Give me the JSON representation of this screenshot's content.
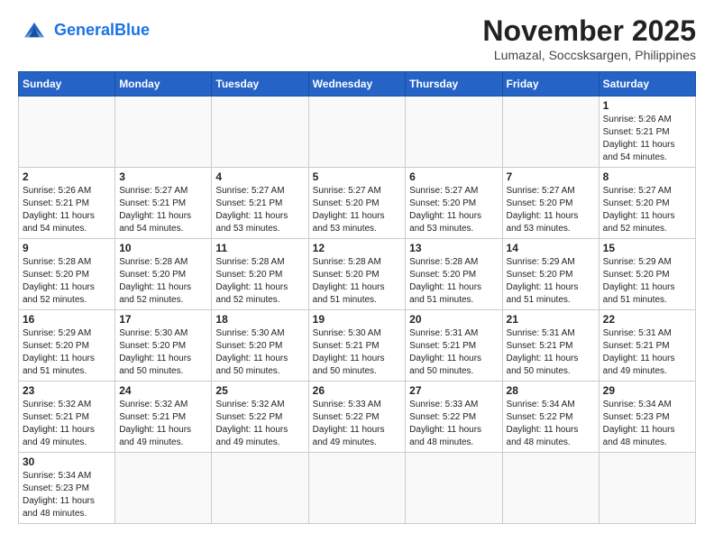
{
  "header": {
    "logo_general": "General",
    "logo_blue": "Blue",
    "month_title": "November 2025",
    "location": "Lumazal, Soccsksargen, Philippines"
  },
  "weekdays": [
    "Sunday",
    "Monday",
    "Tuesday",
    "Wednesday",
    "Thursday",
    "Friday",
    "Saturday"
  ],
  "weeks": [
    [
      {
        "day": "",
        "info": ""
      },
      {
        "day": "",
        "info": ""
      },
      {
        "day": "",
        "info": ""
      },
      {
        "day": "",
        "info": ""
      },
      {
        "day": "",
        "info": ""
      },
      {
        "day": "",
        "info": ""
      },
      {
        "day": "1",
        "info": "Sunrise: 5:26 AM\nSunset: 5:21 PM\nDaylight: 11 hours and 54 minutes."
      }
    ],
    [
      {
        "day": "2",
        "info": "Sunrise: 5:26 AM\nSunset: 5:21 PM\nDaylight: 11 hours and 54 minutes."
      },
      {
        "day": "3",
        "info": "Sunrise: 5:27 AM\nSunset: 5:21 PM\nDaylight: 11 hours and 54 minutes."
      },
      {
        "day": "4",
        "info": "Sunrise: 5:27 AM\nSunset: 5:21 PM\nDaylight: 11 hours and 53 minutes."
      },
      {
        "day": "5",
        "info": "Sunrise: 5:27 AM\nSunset: 5:20 PM\nDaylight: 11 hours and 53 minutes."
      },
      {
        "day": "6",
        "info": "Sunrise: 5:27 AM\nSunset: 5:20 PM\nDaylight: 11 hours and 53 minutes."
      },
      {
        "day": "7",
        "info": "Sunrise: 5:27 AM\nSunset: 5:20 PM\nDaylight: 11 hours and 53 minutes."
      },
      {
        "day": "8",
        "info": "Sunrise: 5:27 AM\nSunset: 5:20 PM\nDaylight: 11 hours and 52 minutes."
      }
    ],
    [
      {
        "day": "9",
        "info": "Sunrise: 5:28 AM\nSunset: 5:20 PM\nDaylight: 11 hours and 52 minutes."
      },
      {
        "day": "10",
        "info": "Sunrise: 5:28 AM\nSunset: 5:20 PM\nDaylight: 11 hours and 52 minutes."
      },
      {
        "day": "11",
        "info": "Sunrise: 5:28 AM\nSunset: 5:20 PM\nDaylight: 11 hours and 52 minutes."
      },
      {
        "day": "12",
        "info": "Sunrise: 5:28 AM\nSunset: 5:20 PM\nDaylight: 11 hours and 51 minutes."
      },
      {
        "day": "13",
        "info": "Sunrise: 5:28 AM\nSunset: 5:20 PM\nDaylight: 11 hours and 51 minutes."
      },
      {
        "day": "14",
        "info": "Sunrise: 5:29 AM\nSunset: 5:20 PM\nDaylight: 11 hours and 51 minutes."
      },
      {
        "day": "15",
        "info": "Sunrise: 5:29 AM\nSunset: 5:20 PM\nDaylight: 11 hours and 51 minutes."
      }
    ],
    [
      {
        "day": "16",
        "info": "Sunrise: 5:29 AM\nSunset: 5:20 PM\nDaylight: 11 hours and 51 minutes."
      },
      {
        "day": "17",
        "info": "Sunrise: 5:30 AM\nSunset: 5:20 PM\nDaylight: 11 hours and 50 minutes."
      },
      {
        "day": "18",
        "info": "Sunrise: 5:30 AM\nSunset: 5:20 PM\nDaylight: 11 hours and 50 minutes."
      },
      {
        "day": "19",
        "info": "Sunrise: 5:30 AM\nSunset: 5:21 PM\nDaylight: 11 hours and 50 minutes."
      },
      {
        "day": "20",
        "info": "Sunrise: 5:31 AM\nSunset: 5:21 PM\nDaylight: 11 hours and 50 minutes."
      },
      {
        "day": "21",
        "info": "Sunrise: 5:31 AM\nSunset: 5:21 PM\nDaylight: 11 hours and 50 minutes."
      },
      {
        "day": "22",
        "info": "Sunrise: 5:31 AM\nSunset: 5:21 PM\nDaylight: 11 hours and 49 minutes."
      }
    ],
    [
      {
        "day": "23",
        "info": "Sunrise: 5:32 AM\nSunset: 5:21 PM\nDaylight: 11 hours and 49 minutes."
      },
      {
        "day": "24",
        "info": "Sunrise: 5:32 AM\nSunset: 5:21 PM\nDaylight: 11 hours and 49 minutes."
      },
      {
        "day": "25",
        "info": "Sunrise: 5:32 AM\nSunset: 5:22 PM\nDaylight: 11 hours and 49 minutes."
      },
      {
        "day": "26",
        "info": "Sunrise: 5:33 AM\nSunset: 5:22 PM\nDaylight: 11 hours and 49 minutes."
      },
      {
        "day": "27",
        "info": "Sunrise: 5:33 AM\nSunset: 5:22 PM\nDaylight: 11 hours and 48 minutes."
      },
      {
        "day": "28",
        "info": "Sunrise: 5:34 AM\nSunset: 5:22 PM\nDaylight: 11 hours and 48 minutes."
      },
      {
        "day": "29",
        "info": "Sunrise: 5:34 AM\nSunset: 5:23 PM\nDaylight: 11 hours and 48 minutes."
      }
    ],
    [
      {
        "day": "30",
        "info": "Sunrise: 5:34 AM\nSunset: 5:23 PM\nDaylight: 11 hours and 48 minutes."
      },
      {
        "day": "",
        "info": ""
      },
      {
        "day": "",
        "info": ""
      },
      {
        "day": "",
        "info": ""
      },
      {
        "day": "",
        "info": ""
      },
      {
        "day": "",
        "info": ""
      },
      {
        "day": "",
        "info": ""
      }
    ]
  ]
}
